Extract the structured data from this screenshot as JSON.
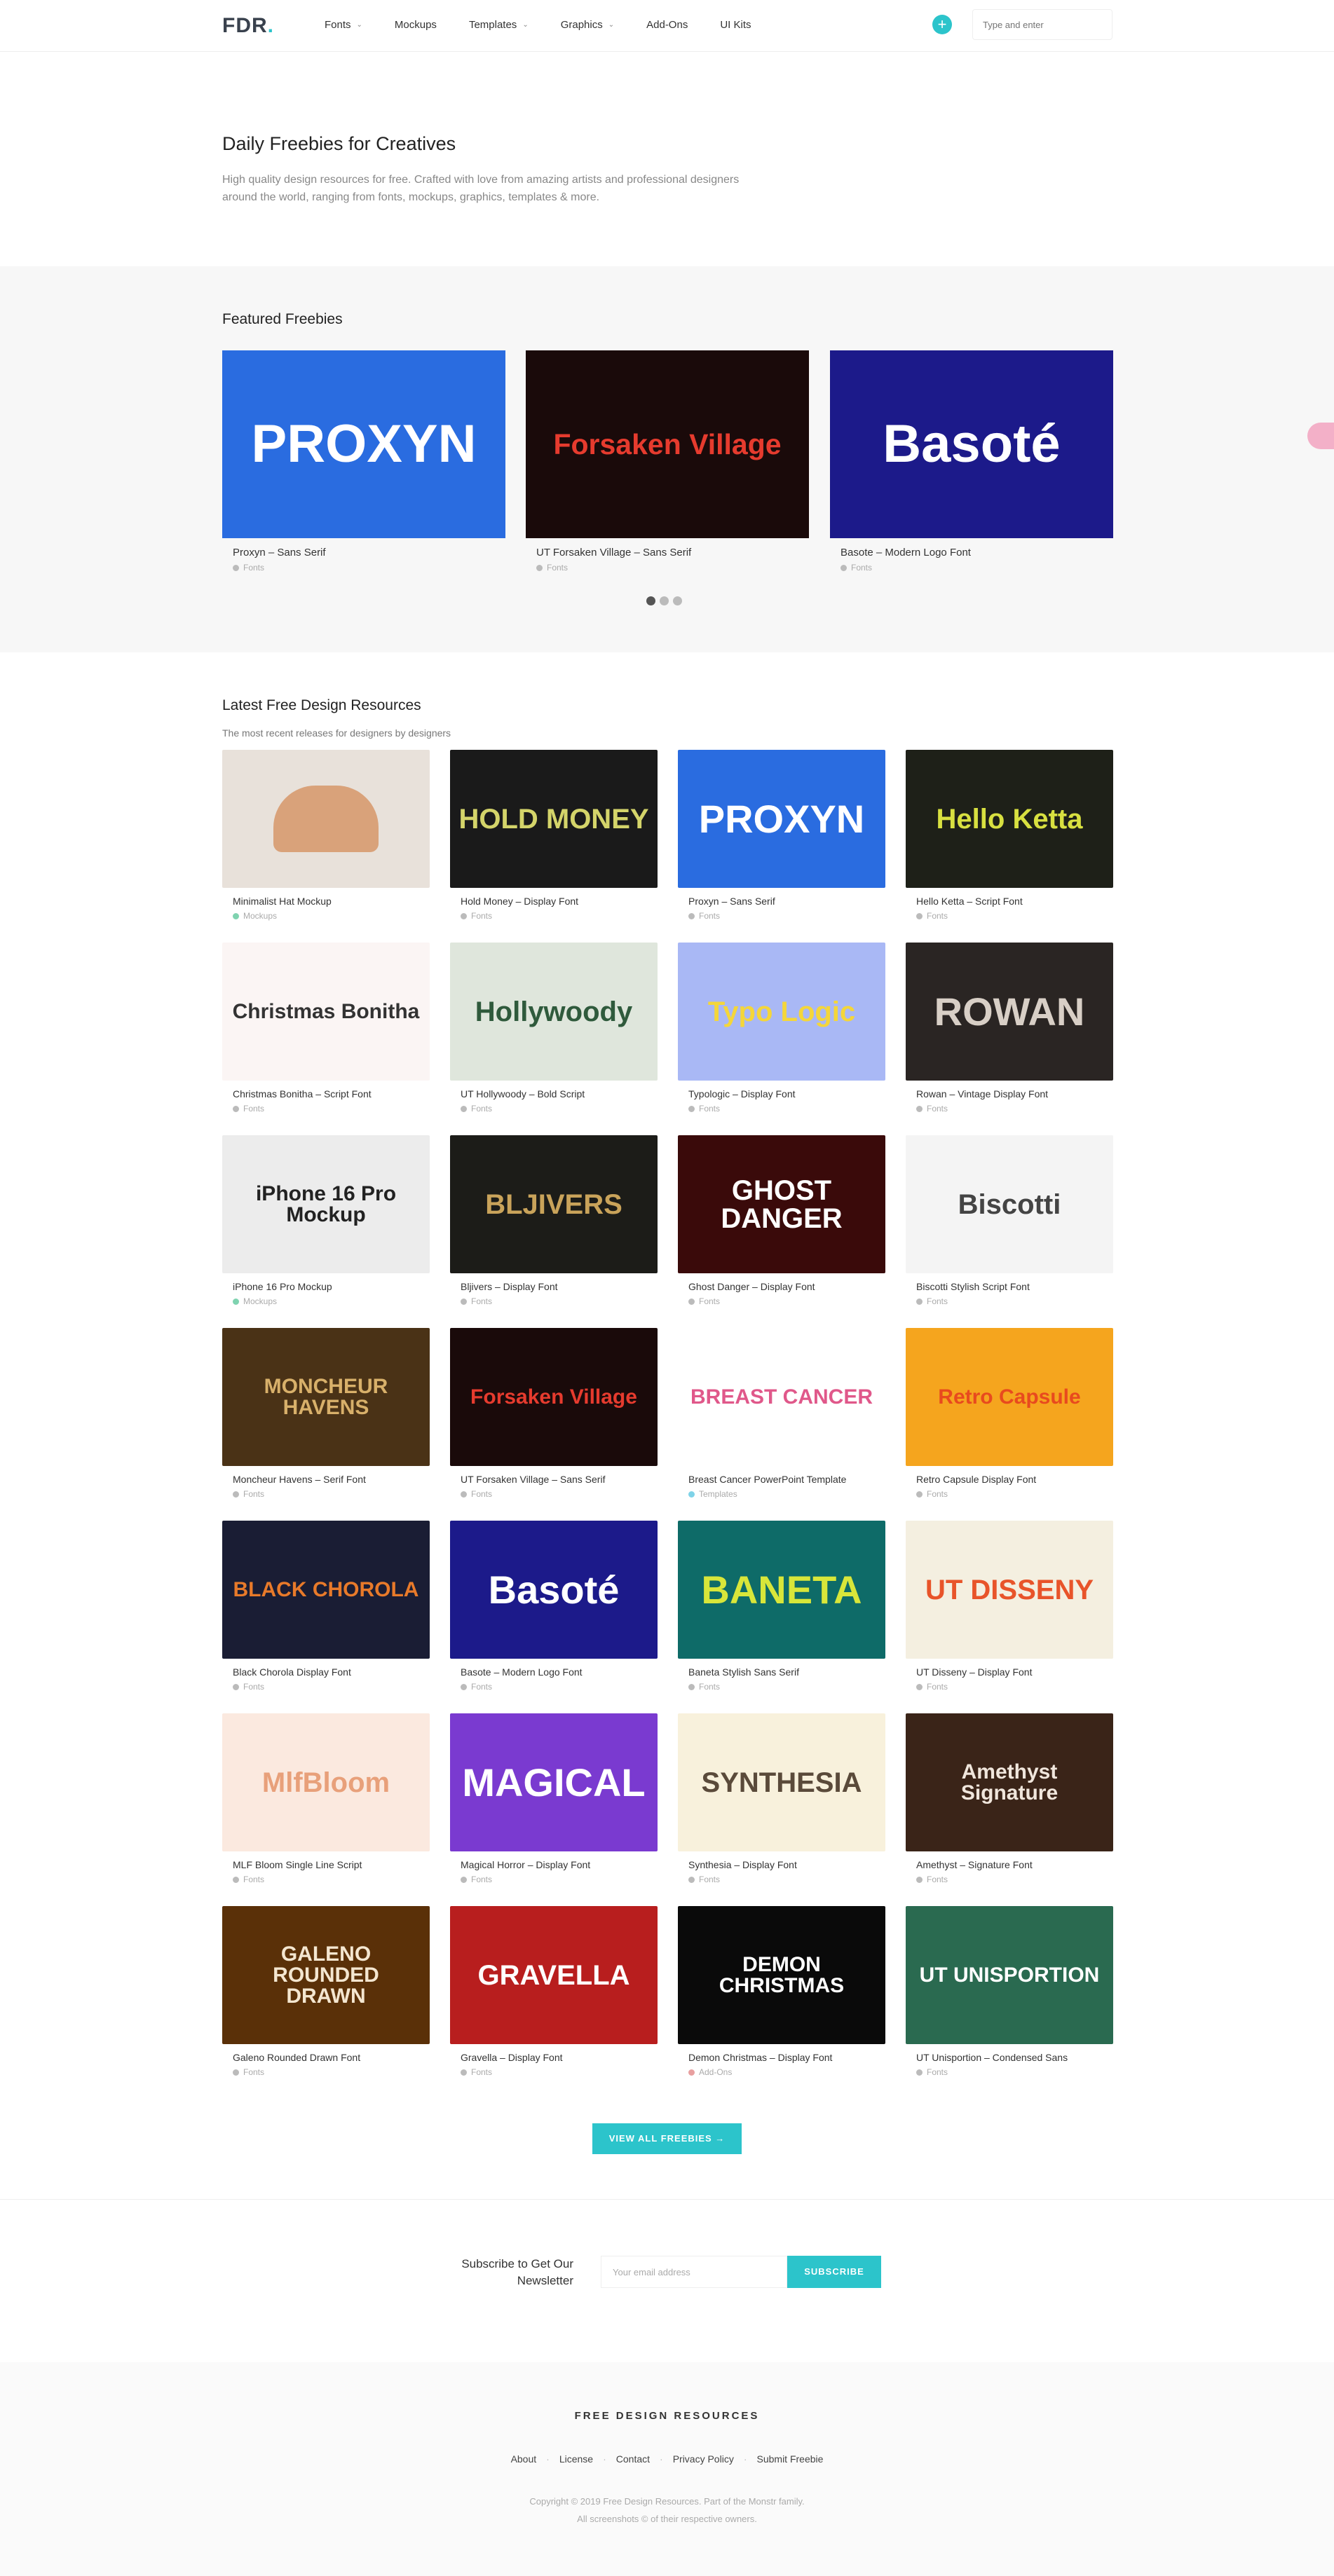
{
  "header": {
    "logo": "FDR",
    "logo_dot": ".",
    "nav": [
      {
        "label": "Fonts",
        "has_dropdown": true
      },
      {
        "label": "Mockups",
        "has_dropdown": false
      },
      {
        "label": "Templates",
        "has_dropdown": true
      },
      {
        "label": "Graphics",
        "has_dropdown": true
      },
      {
        "label": "Add-Ons",
        "has_dropdown": false
      },
      {
        "label": "UI Kits",
        "has_dropdown": false
      }
    ],
    "plus_icon": "plus-icon",
    "plus_symbol": "+",
    "search_placeholder": "Type and enter"
  },
  "hero": {
    "title": "Daily Freebies for Creatives",
    "description": "High quality design resources for free. Crafted with love from amazing artists and professional designers around the world, ranging from fonts, mockups, graphics, templates & more."
  },
  "featured": {
    "title": "Featured Freebies",
    "items": [
      {
        "title": "Proxyn – Sans Serif",
        "category": "Fonts",
        "art": "PROXYN",
        "bg": "#2a6ce0",
        "fg": "#ffffff"
      },
      {
        "title": "UT Forsaken Village – Sans Serif",
        "category": "Fonts",
        "art": "Forsaken Village",
        "bg": "#1a0a0a",
        "fg": "#e63b2e"
      },
      {
        "title": "Basote – Modern Logo Font",
        "category": "Fonts",
        "art": "Basoté",
        "bg": "#1c1a8a",
        "fg": "#ffffff"
      }
    ],
    "active_slide": 0,
    "slide_count": 3
  },
  "latest": {
    "title": "Latest Free Design Resources",
    "subtitle": "The most recent releases for designers by designers",
    "items": [
      {
        "title": "Minimalist Hat Mockup",
        "category": "Mockups",
        "cat_color": "#7fd3b0",
        "art": "",
        "bg": "#e8e1da",
        "fg": "#d9a27a"
      },
      {
        "title": "Hold Money – Display Font",
        "category": "Fonts",
        "cat_color": "#bbbbbb",
        "art": "HOLD MONEY",
        "bg": "#1a1a1a",
        "fg": "#d4d46a"
      },
      {
        "title": "Proxyn – Sans Serif",
        "category": "Fonts",
        "cat_color": "#bbbbbb",
        "art": "PROXYN",
        "bg": "#2a6ce0",
        "fg": "#ffffff"
      },
      {
        "title": "Hello Ketta – Script Font",
        "category": "Fonts",
        "cat_color": "#bbbbbb",
        "art": "Hello Ketta",
        "bg": "#1e2018",
        "fg": "#d8e040"
      },
      {
        "title": "Christmas Bonitha – Script Font",
        "category": "Fonts",
        "cat_color": "#bbbbbb",
        "art": "Christmas Bonitha",
        "bg": "#fbf5f4",
        "fg": "#333333"
      },
      {
        "title": "UT Hollywoody – Bold Script",
        "category": "Fonts",
        "cat_color": "#bbbbbb",
        "art": "Hollywoody",
        "bg": "#dfe6dc",
        "fg": "#2f5a3c"
      },
      {
        "title": "Typologic – Display Font",
        "category": "Fonts",
        "cat_color": "#bbbbbb",
        "art": "Typo Logic",
        "bg": "#a9b8f5",
        "fg": "#f4d63a"
      },
      {
        "title": "Rowan – Vintage Display Font",
        "category": "Fonts",
        "cat_color": "#bbbbbb",
        "art": "ROWAN",
        "bg": "#2a2523",
        "fg": "#d8cfc6"
      },
      {
        "title": "iPhone 16 Pro Mockup",
        "category": "Mockups",
        "cat_color": "#7fd3b0",
        "art": "iPhone 16 Pro Mockup",
        "bg": "#ececec",
        "fg": "#222222"
      },
      {
        "title": "Bljivers – Display Font",
        "category": "Fonts",
        "cat_color": "#bbbbbb",
        "art": "BLJIVERS",
        "bg": "#1c1c18",
        "fg": "#c9a35a"
      },
      {
        "title": "Ghost Danger – Display Font",
        "category": "Fonts",
        "cat_color": "#bbbbbb",
        "art": "GHOST DANGER",
        "bg": "#3a0a0a",
        "fg": "#ffffff"
      },
      {
        "title": "Biscotti Stylish Script Font",
        "category": "Fonts",
        "cat_color": "#bbbbbb",
        "art": "Biscotti",
        "bg": "#f4f4f4",
        "fg": "#444444"
      },
      {
        "title": "Moncheur Havens – Serif Font",
        "category": "Fonts",
        "cat_color": "#bbbbbb",
        "art": "MONCHEUR HAVENS",
        "bg": "#4a3216",
        "fg": "#d8b06a"
      },
      {
        "title": "UT Forsaken Village – Sans Serif",
        "category": "Fonts",
        "cat_color": "#bbbbbb",
        "art": "Forsaken Village",
        "bg": "#1a0a0a",
        "fg": "#e63b2e"
      },
      {
        "title": "Breast Cancer PowerPoint Template",
        "category": "Templates",
        "cat_color": "#7fd3e8",
        "art": "BREAST CANCER",
        "bg": "#ffffff",
        "fg": "#e0588a"
      },
      {
        "title": "Retro Capsule Display Font",
        "category": "Fonts",
        "cat_color": "#bbbbbb",
        "art": "Retro Capsule",
        "bg": "#f5a51e",
        "fg": "#e84a1e"
      },
      {
        "title": "Black Chorola Display Font",
        "category": "Fonts",
        "cat_color": "#bbbbbb",
        "art": "BLACK CHOROLA",
        "bg": "#1a1d34",
        "fg": "#e87a2a"
      },
      {
        "title": "Basote – Modern Logo Font",
        "category": "Fonts",
        "cat_color": "#bbbbbb",
        "art": "Basoté",
        "bg": "#1c1a8a",
        "fg": "#ffffff"
      },
      {
        "title": "Baneta Stylish Sans Serif",
        "category": "Fonts",
        "cat_color": "#bbbbbb",
        "art": "BANETA",
        "bg": "#0e6b68",
        "fg": "#d8e63a"
      },
      {
        "title": "UT Disseny – Display Font",
        "category": "Fonts",
        "cat_color": "#bbbbbb",
        "art": "UT DISSENY",
        "bg": "#f4efe0",
        "fg": "#e8542a"
      },
      {
        "title": "MLF Bloom Single Line Script",
        "category": "Fonts",
        "cat_color": "#bbbbbb",
        "art": "MlfBloom",
        "bg": "#fbe9df",
        "fg": "#e8a07a"
      },
      {
        "title": "Magical Horror – Display Font",
        "category": "Fonts",
        "cat_color": "#bbbbbb",
        "art": "MAGICAL",
        "bg": "#7a3ad0",
        "fg": "#ffffff"
      },
      {
        "title": "Synthesia – Display Font",
        "category": "Fonts",
        "cat_color": "#bbbbbb",
        "art": "SYNTHESIA",
        "bg": "#f8f1dc",
        "fg": "#5a4a3a"
      },
      {
        "title": "Amethyst – Signature Font",
        "category": "Fonts",
        "cat_color": "#bbbbbb",
        "art": "Amethyst Signature",
        "bg": "#3a2418",
        "fg": "#f0e6dc"
      },
      {
        "title": "Galeno Rounded Drawn Font",
        "category": "Fonts",
        "cat_color": "#bbbbbb",
        "art": "GALENO ROUNDED DRAWN",
        "bg": "#5a3008",
        "fg": "#f4e6d0"
      },
      {
        "title": "Gravella – Display Font",
        "category": "Fonts",
        "cat_color": "#bbbbbb",
        "art": "GRAVELLA",
        "bg": "#b81e1e",
        "fg": "#ffffff"
      },
      {
        "title": "Demon Christmas – Display Font",
        "category": "Add-Ons",
        "cat_color": "#e8a0a0",
        "art": "DEMON CHRISTMAS",
        "bg": "#0a0a0a",
        "fg": "#ffffff"
      },
      {
        "title": "UT Unisportion – Condensed Sans",
        "category": "Fonts",
        "cat_color": "#bbbbbb",
        "art": "UT UNISPORTION",
        "bg": "#2a6a50",
        "fg": "#ffffff"
      }
    ],
    "view_all": "VIEW ALL FREEBIES →"
  },
  "newsletter": {
    "line1": "Subscribe to Get Our",
    "line2": "Newsletter",
    "placeholder": "Your email address",
    "button": "SUBSCRIBE"
  },
  "footer": {
    "title": "FREE DESIGN RESOURCES",
    "links": [
      "About",
      "License",
      "Contact",
      "Privacy Policy",
      "Submit Freebie"
    ],
    "copyright": "Copyright © 2019 Free Design Resources. Part of the Monstr family.",
    "copyright2": "All screenshots © of their respective owners."
  }
}
